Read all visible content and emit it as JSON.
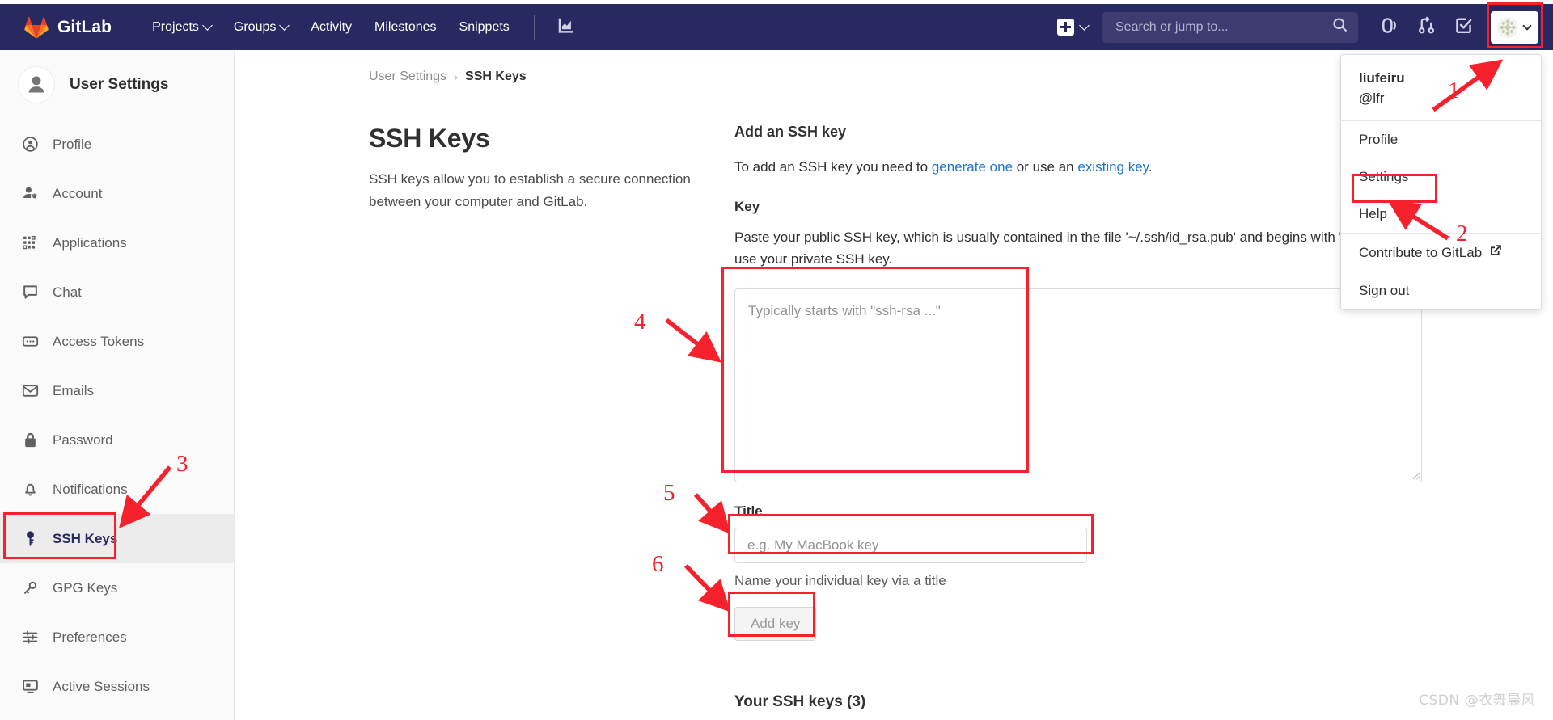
{
  "navbar": {
    "brand": "GitLab",
    "logo_icon": "gitlab-tanuki-logo",
    "links": [
      {
        "label": "Projects",
        "has_caret": true
      },
      {
        "label": "Groups",
        "has_caret": true
      },
      {
        "label": "Activity",
        "has_caret": false
      },
      {
        "label": "Milestones",
        "has_caret": false
      },
      {
        "label": "Snippets",
        "has_caret": false
      }
    ],
    "analytics_icon": "chart-bar-icon",
    "create_new_icon": "plus-square-icon",
    "create_new_caret_icon": "chevron-down-icon",
    "search": {
      "placeholder": "Search or jump to...",
      "value": "",
      "icon": "search-icon"
    },
    "right_icons": [
      {
        "name": "issues-icon"
      },
      {
        "name": "merge-requests-icon"
      },
      {
        "name": "todos-icon"
      }
    ],
    "avatar": {
      "name": "user-avatar",
      "caret_icon": "chevron-down-icon"
    },
    "bg_color": "#292961",
    "search_bg_color": "#3d3b70"
  },
  "user_dropdown": {
    "username": "liufeiru",
    "handle": "@lfr",
    "items": [
      {
        "label": "Profile",
        "external": false
      },
      {
        "label": "Settings",
        "external": false
      },
      {
        "label": "Help",
        "external": false
      },
      {
        "label": "Contribute to GitLab",
        "external": true
      },
      {
        "label": "Sign out",
        "external": false
      }
    ],
    "external_icon": "external-link-icon"
  },
  "sidebar": {
    "title": "User Settings",
    "avatar_icon": "user-avatar-icon",
    "items": [
      {
        "label": "Profile",
        "icon": "profile-icon",
        "active": false
      },
      {
        "label": "Account",
        "icon": "account-gear-icon",
        "active": false
      },
      {
        "label": "Applications",
        "icon": "applications-grid-icon",
        "active": false
      },
      {
        "label": "Chat",
        "icon": "chat-bubble-icon",
        "active": false
      },
      {
        "label": "Access Tokens",
        "icon": "token-icon",
        "active": false
      },
      {
        "label": "Emails",
        "icon": "envelope-icon",
        "active": false
      },
      {
        "label": "Password",
        "icon": "lock-icon",
        "active": false
      },
      {
        "label": "Notifications",
        "icon": "bell-icon",
        "active": false
      },
      {
        "label": "SSH Keys",
        "icon": "key-icon",
        "active": true
      },
      {
        "label": "GPG Keys",
        "icon": "gpg-key-icon",
        "active": false
      },
      {
        "label": "Preferences",
        "icon": "sliders-icon",
        "active": false
      },
      {
        "label": "Active Sessions",
        "icon": "monitor-icon",
        "active": false
      }
    ]
  },
  "breadcrumb": {
    "parent": "User Settings",
    "separator": "›",
    "current": "SSH Keys"
  },
  "main": {
    "page_title": "SSH Keys",
    "page_description": "SSH keys allow you to establish a secure connection between your computer and GitLab.",
    "add_section": {
      "heading": "Add an SSH key",
      "intro_prefix": "To add an SSH key you need to ",
      "link_generate": "generate one",
      "intro_middle": " or use an ",
      "link_existing": "existing key",
      "intro_suffix": ".",
      "key_label": "Key",
      "key_help": "Paste your public SSH key, which is usually contained in the file '~/.ssh/id_rsa.pub' and begins with 'ssh-rsa'. Don't use your private SSH key.",
      "key_placeholder": "Typically starts with \"ssh-rsa ...\"",
      "key_value": "",
      "title_label": "Title",
      "title_placeholder": "e.g. My MacBook key",
      "title_value": "",
      "title_hint": "Name your individual key via a title",
      "add_button": "Add key",
      "resize_handle_icon": "resize-grip-icon"
    },
    "keys_list_heading": "Your SSH keys (3)"
  },
  "annotations": {
    "color": "#f5222d",
    "markers": [
      {
        "number": "1",
        "target": "avatar-dropdown-toggle"
      },
      {
        "number": "2",
        "target": "dropdown-settings-item"
      },
      {
        "number": "3",
        "target": "sidebar-ssh-keys"
      },
      {
        "number": "4",
        "target": "key-textarea"
      },
      {
        "number": "5",
        "target": "title-input"
      },
      {
        "number": "6",
        "target": "add-key-button"
      }
    ]
  },
  "watermark": "CSDN @衣舞晨风"
}
